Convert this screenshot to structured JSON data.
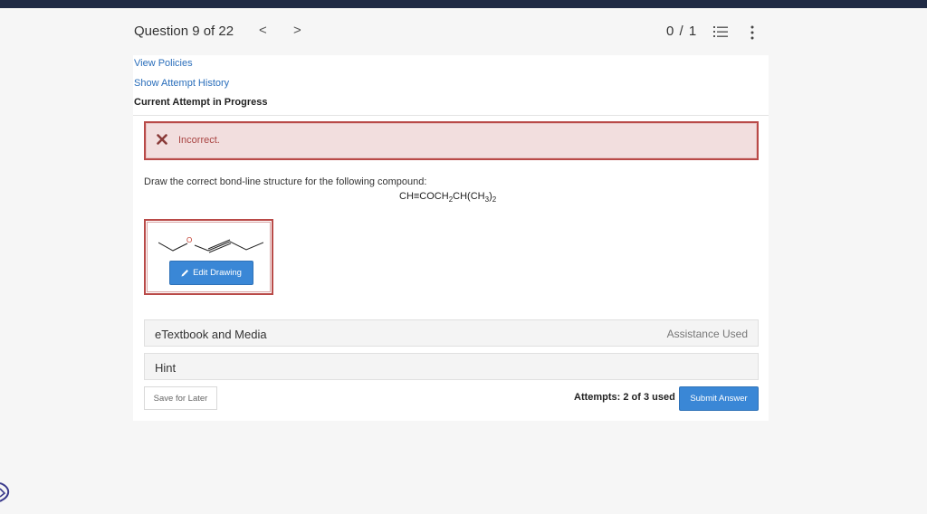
{
  "header": {
    "question_label": "Question 9 of 22",
    "prev_symbol": "<",
    "next_symbol": ">",
    "score": "0 / 1",
    "list_icon": "list-icon",
    "more_icon": "more-vertical-icon"
  },
  "links": {
    "view_policies": "View Policies",
    "attempt_history": "Show Attempt History"
  },
  "status": {
    "current_attempt": "Current Attempt in Progress",
    "result": "Incorrect.",
    "result_icon": "x-icon"
  },
  "question": {
    "prompt": "Draw the correct bond-line structure for the following compound:",
    "formula_parts": [
      "CH≡COCH",
      "2",
      "CH(CH",
      "3",
      ")",
      "2"
    ],
    "atom_label": "O"
  },
  "drawing": {
    "edit_label": "Edit Drawing",
    "edit_icon": "pencil-icon"
  },
  "accordions": {
    "etextbook": "eTextbook and Media",
    "assistance": "Assistance Used",
    "hint": "Hint"
  },
  "footer": {
    "save_label": "Save for Later",
    "attempts": "Attempts: 2 of 3 used",
    "submit_label": "Submit Answer"
  },
  "colors": {
    "accent": "#3a87d6",
    "error_border": "#b94a48",
    "error_bg": "#f2dede",
    "link": "#2a6ebb",
    "topbar": "#1f2a44"
  }
}
